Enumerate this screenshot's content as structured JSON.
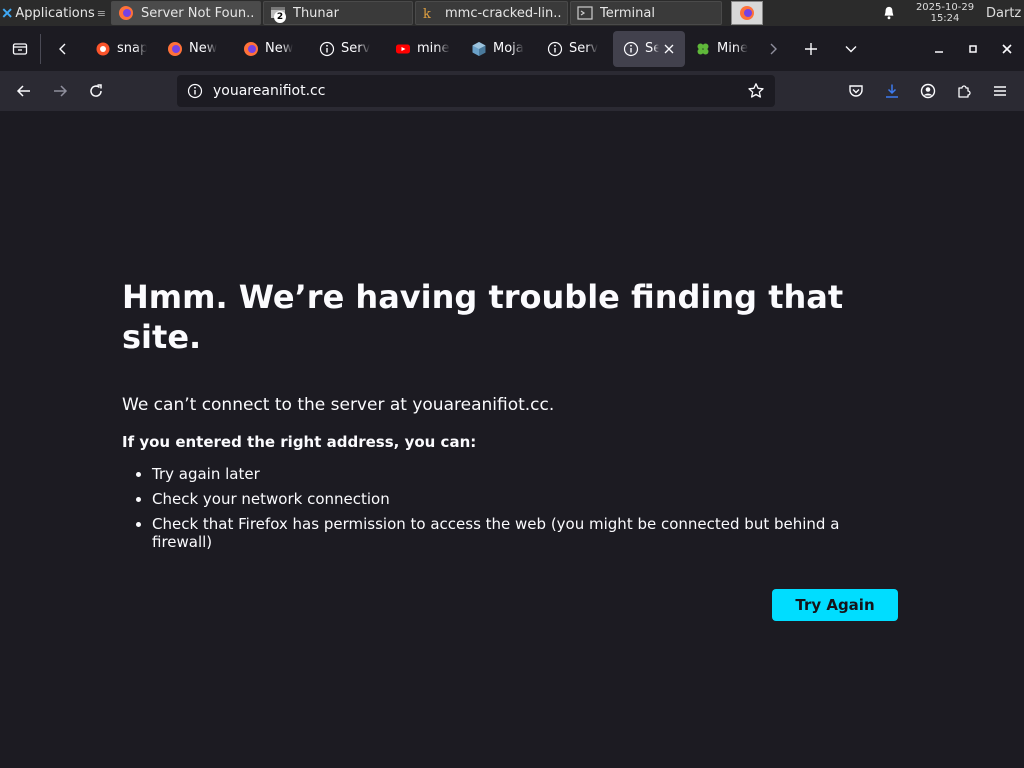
{
  "panel": {
    "apps_label": "Applications",
    "tasks": [
      {
        "label": "Server Not Foun...",
        "icon": "firefox-icon"
      },
      {
        "label": "Thunar",
        "icon": "file-manager-icon",
        "badge": "2"
      },
      {
        "label": "mmc-cracked-lin...",
        "icon": "launcher-icon"
      },
      {
        "label": "Terminal",
        "icon": "terminal-icon"
      }
    ],
    "date": "2025-10-29",
    "time": "15:24",
    "user": "Dartz"
  },
  "tabs": [
    {
      "label": "snap",
      "icon": "brave-icon"
    },
    {
      "label": "New",
      "icon": "firefox-icon"
    },
    {
      "label": "New",
      "icon": "firefox-icon"
    },
    {
      "label": "Serv",
      "icon": "info-icon"
    },
    {
      "label": "mine",
      "icon": "youtube-icon"
    },
    {
      "label": "Moja",
      "icon": "cube-icon"
    },
    {
      "label": "Serv",
      "icon": "info-icon"
    },
    {
      "label": "Se",
      "icon": "info-icon",
      "selected": true
    },
    {
      "label": "Mine",
      "icon": "clover-icon"
    }
  ],
  "urlbar": {
    "value": "youareanifiot.cc"
  },
  "error": {
    "title": "Hmm. We’re having trouble finding that site.",
    "description": "We can’t connect to the server at youareanifiot.cc.",
    "subtitle": "If you entered the right address, you can:",
    "suggestions": [
      "Try again later",
      "Check your network connection",
      "Check that Firefox has permission to access the web (you might be connected but behind a firewall)"
    ],
    "button": "Try Again"
  },
  "colors": {
    "accent": "#00ddff",
    "page_bg": "#1c1b22",
    "toolbar_bg": "#2b2a33"
  }
}
